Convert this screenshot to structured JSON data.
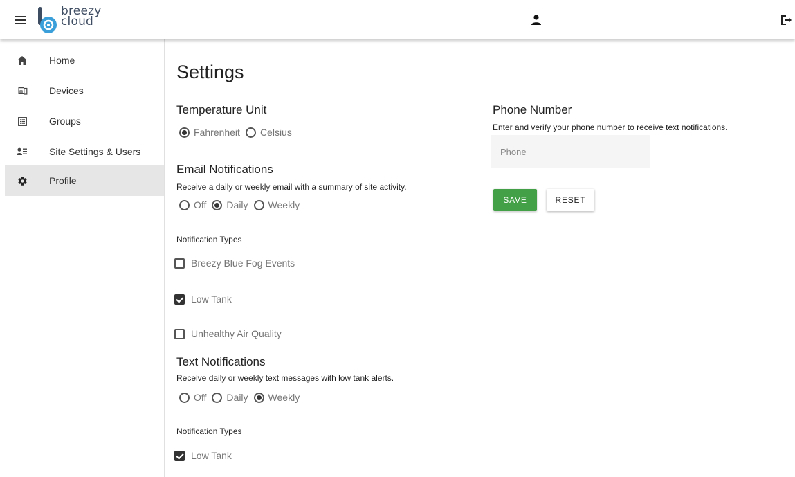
{
  "header": {
    "logo_line1": "breezy",
    "logo_line2": "cloud"
  },
  "sidebar": {
    "items": [
      {
        "label": "Home"
      },
      {
        "label": "Devices"
      },
      {
        "label": "Groups"
      },
      {
        "label": "Site Settings & Users"
      },
      {
        "label": "Profile"
      }
    ],
    "active": "Profile"
  },
  "main": {
    "title": "Settings",
    "temperature": {
      "heading": "Temperature Unit",
      "options": [
        "Fahrenheit",
        "Celsius"
      ],
      "selected": "Fahrenheit"
    },
    "email": {
      "heading": "Email Notifications",
      "description": "Receive a daily or weekly email with a summary of site activity.",
      "options": [
        "Off",
        "Daily",
        "Weekly"
      ],
      "selected": "Daily",
      "types_label": "Notification Types",
      "types": [
        {
          "label": "Breezy Blue Fog Events",
          "checked": false
        },
        {
          "label": "Low Tank",
          "checked": true
        },
        {
          "label": "Unhealthy Air Quality",
          "checked": false
        }
      ]
    },
    "text": {
      "heading": "Text Notifications",
      "description": "Receive daily or weekly text messages with low tank alerts.",
      "options": [
        "Off",
        "Daily",
        "Weekly"
      ],
      "selected": "Weekly",
      "types_label": "Notification Types",
      "types": [
        {
          "label": "Low Tank",
          "checked": true
        }
      ]
    },
    "phone": {
      "heading": "Phone Number",
      "description": "Enter and verify your phone number to receive text notifications.",
      "placeholder": "Phone",
      "value": ""
    },
    "buttons": {
      "save": "SAVE",
      "reset": "RESET"
    }
  },
  "colors": {
    "save_button": "#43a047",
    "active_nav": "#e6e6e6",
    "logo": "#3f4d63",
    "logo_accent": "#3ba0d9"
  },
  "icons": [
    "menu-icon",
    "home-icon",
    "devices-icon",
    "groups-icon",
    "site-settings-icon",
    "gear-icon",
    "user-icon",
    "logout-icon"
  ]
}
